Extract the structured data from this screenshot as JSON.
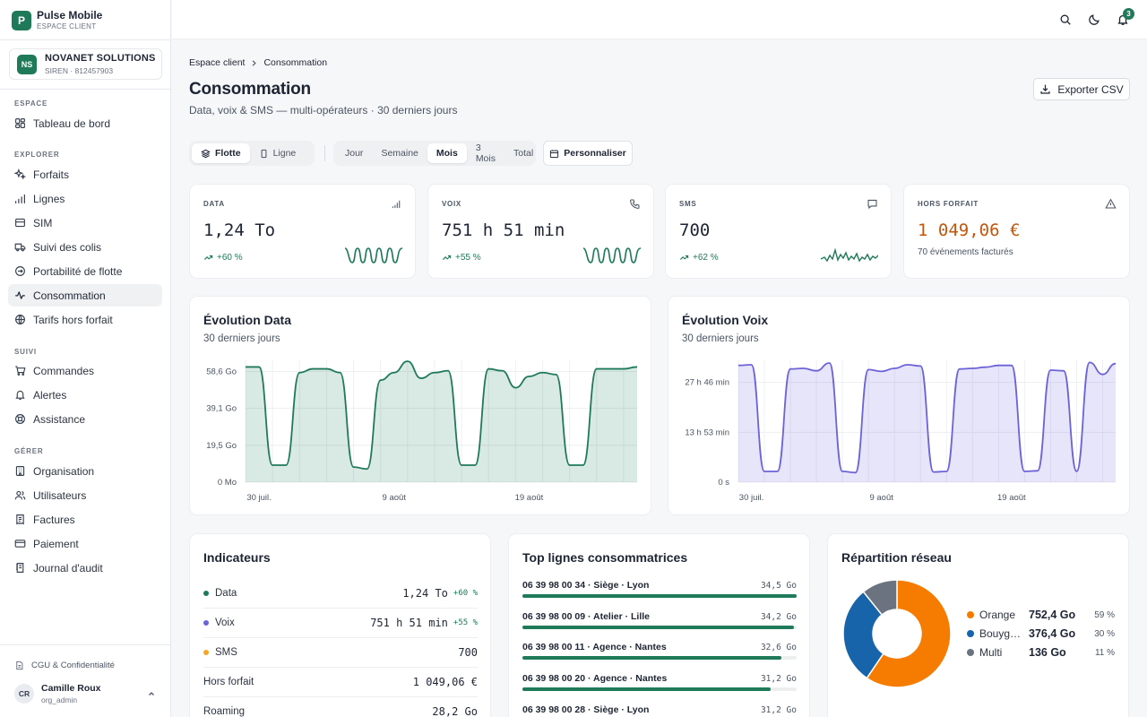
{
  "brand": {
    "name": "Pulse Mobile",
    "subtitle": "ESPACE CLIENT",
    "logo": "P"
  },
  "org": {
    "initials": "NS",
    "name": "NOVANET SOLUTIONS",
    "siren": "SIREN · 812457903"
  },
  "nav": {
    "sections": [
      "ESPACE",
      "EXPLORER",
      "SUIVI",
      "GÉRER"
    ],
    "items": [
      {
        "label": "Tableau de bord",
        "icon": "dashboard-icon"
      },
      {
        "label": "Forfaits",
        "icon": "sparkles-icon"
      },
      {
        "label": "Lignes",
        "icon": "signal-icon"
      },
      {
        "label": "SIM",
        "icon": "sim-card-icon"
      },
      {
        "label": "Suivi des colis",
        "icon": "truck-icon"
      },
      {
        "label": "Portabilité de flotte",
        "icon": "transfer-icon"
      },
      {
        "label": "Consommation",
        "icon": "activity-icon",
        "active": true
      },
      {
        "label": "Tarifs hors forfait",
        "icon": "globe-icon"
      },
      {
        "label": "Commandes",
        "icon": "cart-icon"
      },
      {
        "label": "Alertes",
        "icon": "bell-icon"
      },
      {
        "label": "Assistance",
        "icon": "lifebuoy-icon"
      },
      {
        "label": "Organisation",
        "icon": "building-icon"
      },
      {
        "label": "Utilisateurs",
        "icon": "users-icon"
      },
      {
        "label": "Factures",
        "icon": "invoice-icon"
      },
      {
        "label": "Paiement",
        "icon": "credit-card-icon"
      },
      {
        "label": "Journal d'audit",
        "icon": "audit-log-icon"
      }
    ]
  },
  "footer": {
    "legal": "CGU & Confidentialité",
    "user_initials": "CR",
    "user_name": "Camille Roux",
    "user_role": "org_admin"
  },
  "topbar": {
    "notifications": "3"
  },
  "breadcrumb": {
    "root": "Espace client",
    "current": "Consommation"
  },
  "page": {
    "title": "Consommation",
    "subtitle": "Data, voix & SMS — multi-opérateurs · 30 derniers jours",
    "export_label": "Exporter CSV"
  },
  "scope": {
    "options": [
      "Flotte",
      "Ligne"
    ],
    "selected": "Flotte"
  },
  "period": {
    "options": [
      "Jour",
      "Semaine",
      "Mois",
      "3 Mois",
      "Total"
    ],
    "selected": "Mois"
  },
  "customize_label": "Personnaliser",
  "kpis": [
    {
      "label": "DATA",
      "value": "1,24 To",
      "delta": "+60 %",
      "icon": "signal-bars-icon"
    },
    {
      "label": "VOIX",
      "value": "751 h 51 min",
      "delta": "+55 %",
      "icon": "phone-icon"
    },
    {
      "label": "SMS",
      "value": "700",
      "delta": "+62 %",
      "icon": "message-icon"
    },
    {
      "label": "HORS FORFAIT",
      "value": "1 049,06 €",
      "note": "70 événements facturés",
      "icon": "warning-icon"
    }
  ],
  "colors": {
    "accent": "#1f7a5a",
    "voice": "#6c63d9",
    "warning": "#c2560c",
    "orange": "#f57c00",
    "bouygues": "#1864ab",
    "multi": "#6b7280"
  },
  "chart_data": [
    {
      "type": "area",
      "title": "Évolution Data",
      "subtitle": "30 derniers jours",
      "x": [
        "29 juil.",
        "30 juil.",
        "31 juil.",
        "1 août",
        "2 août",
        "3 août",
        "4 août",
        "5 août",
        "6 août",
        "7 août",
        "8 août",
        "9 août",
        "10 août",
        "11 août",
        "12 août",
        "13 août",
        "14 août",
        "15 août",
        "16 août",
        "17 août",
        "18 août",
        "19 août",
        "20 août",
        "21 août",
        "22 août",
        "23 août",
        "24 août",
        "25 août",
        "26 août",
        "27 août"
      ],
      "x_ticks": [
        "30 juil.",
        "9 août",
        "19 août"
      ],
      "y_ticks": [
        "0 Mo",
        "19,5 Go",
        "39,1 Go",
        "58,6 Go"
      ],
      "y_unit": "Go",
      "ylim": [
        0,
        65
      ],
      "series": [
        {
          "values": [
            61,
            61,
            9,
            9,
            58,
            60,
            60,
            58,
            8,
            7,
            54,
            58,
            64,
            55,
            58,
            59,
            9,
            9,
            60,
            59,
            50,
            56,
            58,
            57,
            9,
            9,
            60,
            60,
            60,
            61
          ]
        }
      ]
    },
    {
      "type": "area",
      "title": "Évolution Voix",
      "subtitle": "30 derniers jours",
      "x": [
        "29 juil.",
        "30 juil.",
        "31 juil.",
        "1 août",
        "2 août",
        "3 août",
        "4 août",
        "5 août",
        "6 août",
        "7 août",
        "8 août",
        "9 août",
        "10 août",
        "11 août",
        "12 août",
        "13 août",
        "14 août",
        "15 août",
        "16 août",
        "17 août",
        "18 août",
        "19 août",
        "20 août",
        "21 août",
        "22 août",
        "23 août",
        "24 août",
        "25 août",
        "26 août",
        "27 août"
      ],
      "x_ticks": [
        "30 juil.",
        "9 août",
        "19 août"
      ],
      "y_ticks": [
        "0 s",
        "13 h 53 min",
        "27 h 46 min"
      ],
      "y_unit": "min",
      "ylim": [
        0,
        2050
      ],
      "series": [
        {
          "values": [
            1950,
            1960,
            180,
            180,
            1890,
            1900,
            1860,
            1990,
            180,
            160,
            1880,
            1850,
            1900,
            1960,
            1940,
            170,
            180,
            1890,
            1900,
            1920,
            1950,
            1950,
            180,
            190,
            1870,
            1860,
            180,
            2000,
            1800,
            1980
          ]
        }
      ]
    },
    {
      "type": "pie",
      "title": "Répartition réseau",
      "labels": [
        "Orange",
        "Bouygues Telecom",
        "Multi"
      ],
      "legend_labels": [
        "Orange",
        "Bouyg…",
        "Multi"
      ],
      "display_values": [
        "752,4 Go",
        "376,4 Go",
        "136 Go"
      ],
      "values": [
        752.4,
        376.4,
        136
      ],
      "percent": [
        "59 %",
        "30 %",
        "11 %"
      ]
    }
  ],
  "indicators": {
    "title": "Indicateurs",
    "rows": [
      {
        "label": "Data",
        "value": "1,24 To",
        "delta": "+60 %",
        "dot": "#1f7a5a"
      },
      {
        "label": "Voix",
        "value": "751 h 51 min",
        "delta": "+55 %",
        "dot": "#6c63d9"
      },
      {
        "label": "SMS",
        "value": "700",
        "dot": "#f5a623"
      },
      {
        "label": "Hors forfait",
        "value": "1 049,06 €"
      },
      {
        "label": "Roaming",
        "value": "28,2 Go"
      }
    ]
  },
  "top_lines": {
    "title": "Top lignes consommatrices",
    "rows": [
      {
        "line": "06 39 98 00 34 · Siège · Lyon",
        "value": "34,5 Go",
        "fraction": 1.0
      },
      {
        "line": "06 39 98 00 09 · Atelier · Lille",
        "value": "34,2 Go",
        "fraction": 0.99
      },
      {
        "line": "06 39 98 00 11 · Agence · Nantes",
        "value": "32,6 Go",
        "fraction": 0.945
      },
      {
        "line": "06 39 98 00 20 · Agence · Nantes",
        "value": "31,2 Go",
        "fraction": 0.905
      },
      {
        "line": "06 39 98 00 28 · Siège · Lyon",
        "value": "31,2 Go",
        "fraction": 0.905
      }
    ]
  }
}
